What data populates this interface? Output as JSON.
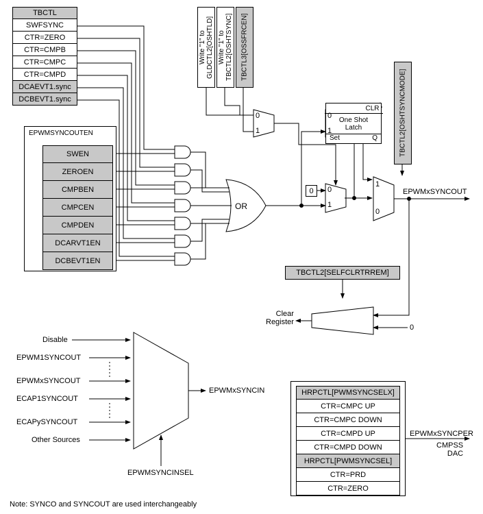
{
  "top_col": {
    "hdr": "TBCTL",
    "r1": "SWFSYNC",
    "r2": "CTR=ZERO",
    "r3": "CTR=CMPB",
    "r4": "CTR=CMPC",
    "r5": "CTR=CMPD",
    "r6": "DCAEVT1.sync",
    "r7": "DCBEVT1.sync"
  },
  "enable_hdr": "EPWMSYNCOUTEN",
  "enable": {
    "r1": "SWEN",
    "r2": "ZEROEN",
    "r3": "CMPBEN",
    "r4": "CMPCEN",
    "r5": "CMPDEN",
    "r6": "DCARVT1EN",
    "r7": "DCBEVT1EN"
  },
  "writes": {
    "w1": "Write \"1\" to\nGLDCTL2[OSHTLD]",
    "w2": "Write \"1\" to\nTBCTL2[OSHTSYNC]",
    "w3": "TBCTL3[OSSFRCEN]"
  },
  "latch": {
    "clr": "CLR",
    "title": "One Shot\nLatch",
    "set": "Set",
    "q": "Q"
  },
  "oshtsyncmode": "TBCTL2[OSHTSYNCMODE]",
  "or_label": "OR",
  "zero_box": "0",
  "mux_top": {
    "a": "0",
    "b": "1"
  },
  "mux_bot": {
    "a": "0",
    "b": "1"
  },
  "mux_out": {
    "a": "1",
    "b": "0"
  },
  "out_label": "EPWMxSYNCOUT",
  "selfclr": "TBCTL2[SELFCLRTRREM]",
  "clear_reg": "Clear\nRegister",
  "zero_src": "0",
  "syncin": {
    "s1": "Disable",
    "s2": "EPWM1SYNCOUT",
    "s3": "EPWMxSYNCOUT",
    "s4": "ECAP1SYNCOUT",
    "s5": "ECAPySYNCOUT",
    "s6": "Other Sources"
  },
  "syncin_out": "EPWMxSYNCIN",
  "syncin_sel": "EPWMSYNCINSEL",
  "syncper_hdr1": "HRPCTL[PWMSYNCSELX]",
  "syncper": {
    "r1": "CTR=CMPC UP",
    "r2": "CTR=CMPC DOWN",
    "r3": "CTR=CMPD UP",
    "r4": "CTR=CMPD DOWN"
  },
  "syncper_hdr2": "HRPCTL[PWMSYNCSEL]",
  "syncper2": {
    "r1": "CTR=PRD",
    "r2": "CTR=ZERO"
  },
  "syncper_out": "EPWMxSYNCPER",
  "syncper_dst": "CMPSS\nDAC",
  "note": "Note: SYNCO and SYNCOUT are used interchangeably"
}
